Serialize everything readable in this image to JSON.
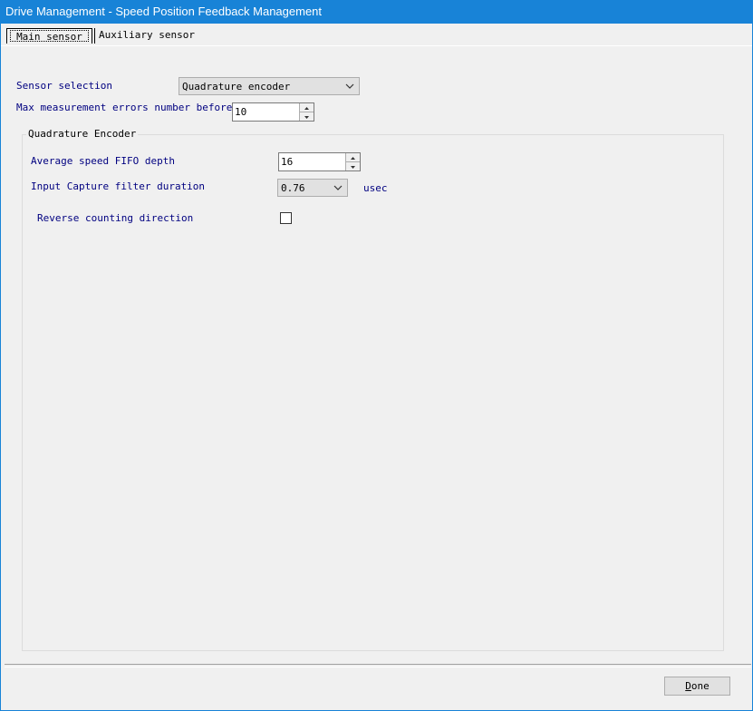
{
  "window": {
    "title": "Drive Management - Speed Position Feedback Management"
  },
  "tabs": [
    {
      "label": "Main sensor",
      "active": true
    },
    {
      "label": "Auxiliary sensor",
      "active": false
    }
  ],
  "main": {
    "sensor_selection": {
      "label": "Sensor selection",
      "value": "Quadrature encoder"
    },
    "max_errors": {
      "label": "Max measurement errors number before",
      "value": "10"
    },
    "group": {
      "title": "Quadrature Encoder",
      "fifo_depth": {
        "label": "Average speed FIFO depth",
        "value": "16"
      },
      "capture_filter": {
        "label": "Input Capture filter duration",
        "value": "0.76",
        "unit": "usec"
      },
      "reverse": {
        "label": "Reverse counting direction",
        "checked": false
      }
    }
  },
  "footer": {
    "done_label_first": "D",
    "done_label_rest": "one"
  },
  "colors": {
    "titlebar": "#1883d7",
    "label_blue": "#000080",
    "background": "#f0f0f0"
  }
}
